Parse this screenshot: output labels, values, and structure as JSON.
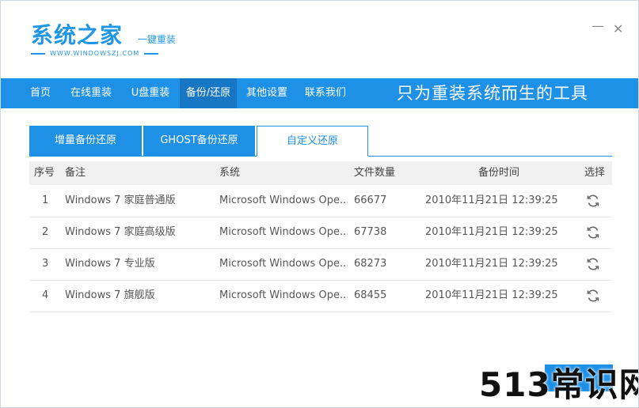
{
  "app": {
    "title": "系统之家",
    "subtitle": "一键重装",
    "url": "WWW.WINDOWSZJ.COM"
  },
  "window_controls": {
    "minimize": "—",
    "close": "✕"
  },
  "nav": {
    "items": [
      {
        "label": "首页"
      },
      {
        "label": "在线重装"
      },
      {
        "label": "U盘重装"
      },
      {
        "label": "备份/还原"
      },
      {
        "label": "其他设置"
      },
      {
        "label": "联系我们"
      }
    ],
    "active_index": 3,
    "slogan": "只为重装系统而生的工具"
  },
  "tabs": [
    {
      "label": "增量备份还原"
    },
    {
      "label": "GHOST备份还原"
    },
    {
      "label": "自定义还原"
    }
  ],
  "table": {
    "headers": [
      "序号",
      "备注",
      "系统",
      "文件数量",
      "备份时间",
      "选择"
    ],
    "rows": [
      {
        "index": "1",
        "note": "Windows 7 家庭普通版",
        "system": "Microsoft Windows Ope...",
        "files": "66677",
        "time": "2010年11月21日 12:39:25"
      },
      {
        "index": "2",
        "note": "Windows 7 家庭高级版",
        "system": "Microsoft Windows Ope...",
        "files": "67738",
        "time": "2010年11月21日 12:39:25"
      },
      {
        "index": "3",
        "note": "Windows 7 专业版",
        "system": "Microsoft Windows Ope...",
        "files": "68273",
        "time": "2010年11月21日 12:39:25"
      },
      {
        "index": "4",
        "note": "Windows 7 旗舰版",
        "system": "Microsoft Windows Ope...",
        "files": "68455",
        "time": "2010年11月21日 12:39:25"
      }
    ],
    "select_icon": "restore-icon"
  },
  "watermark": "513常识网",
  "colors": {
    "accent": "#1e90e6",
    "accent_dark": "#1877c4",
    "logo": "#1f96e6"
  }
}
